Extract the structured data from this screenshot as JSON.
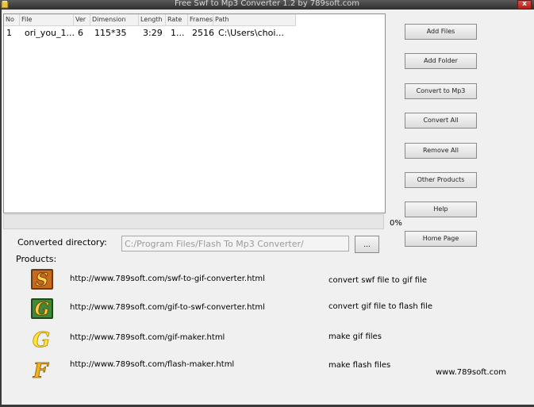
{
  "window": {
    "title": "Free Swf to Mp3 Converter 1.2 by 789soft.com",
    "close_glyph": "x"
  },
  "list": {
    "columns": [
      "No",
      "File",
      "Ver",
      "Dimension",
      "Length",
      "Rate",
      "Frames",
      "Path"
    ],
    "rows": [
      {
        "no": "1",
        "file": "ori_you_1...",
        "ver": "6",
        "dimension": "115*35",
        "length": "3:29",
        "rate": "1...",
        "frames": "2516",
        "path": "C:\\Users\\choi..."
      }
    ]
  },
  "progress": {
    "value": 0,
    "text": "0%"
  },
  "buttons": {
    "add_files": "Add Files",
    "add_folder": "Add Folder",
    "convert_mp3": "Convert to Mp3",
    "convert_all": "Convert All",
    "remove_all": "Remove All",
    "other_products": "Other Products",
    "help": "Help",
    "home_page": "Home Page",
    "browse": "..."
  },
  "converted_directory": {
    "label": "Converted directory:",
    "value": "C:/Program Files/Flash To Mp3 Converter/"
  },
  "products": {
    "label": "Products:",
    "items": [
      {
        "icon": "swf-to-gif-icon",
        "letter": "S",
        "url": "http://www.789soft.com/swf-to-gif-converter.html",
        "desc": "convert swf file to gif file"
      },
      {
        "icon": "gif-to-swf-icon",
        "letter": "G",
        "url": "http://www.789soft.com/gif-to-swf-converter.html",
        "desc": "convert gif file to flash file"
      },
      {
        "icon": "gif-maker-icon",
        "letter": "G",
        "url": "http://www.789soft.com/gif-maker.html",
        "desc": "make gif files"
      },
      {
        "icon": "flash-maker-icon",
        "letter": "F",
        "url": "http://www.789soft.com/flash-maker.html",
        "desc": "make flash files"
      }
    ]
  },
  "site": "www.789soft.com"
}
